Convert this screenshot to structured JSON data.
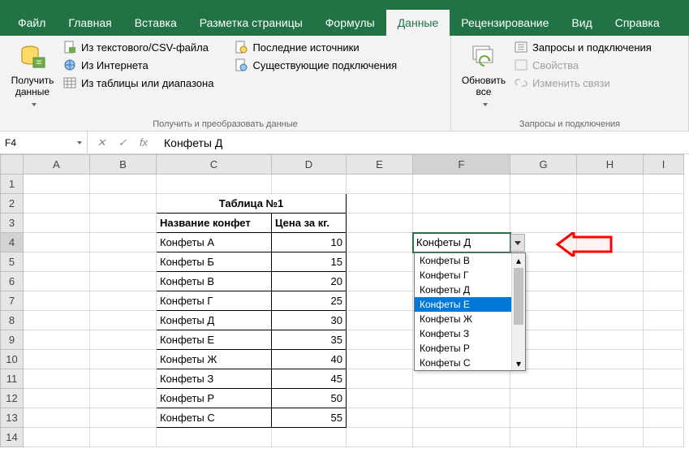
{
  "tabs": [
    "Файл",
    "Главная",
    "Вставка",
    "Разметка страницы",
    "Формулы",
    "Данные",
    "Рецензирование",
    "Вид",
    "Справка"
  ],
  "active_tab": "Данные",
  "ribbon": {
    "group1": {
      "get_data": "Получить\nданные",
      "from_text_csv": "Из текстового/CSV-файла",
      "from_web": "Из Интернета",
      "from_table": "Из таблицы или диапазона",
      "recent": "Последние источники",
      "existing": "Существующие подключения",
      "label": "Получить и преобразовать данные"
    },
    "group2": {
      "refresh": "Обновить\nвсе",
      "queries": "Запросы и подключения",
      "properties": "Свойства",
      "edit_links": "Изменить связи",
      "label": "Запросы и подключения"
    }
  },
  "namebox": "F4",
  "formula": "Конфеты Д",
  "columns": [
    "A",
    "B",
    "C",
    "D",
    "E",
    "F",
    "G",
    "H",
    "I"
  ],
  "rows": [
    1,
    2,
    3,
    4,
    5,
    6,
    7,
    8,
    9,
    10,
    11,
    12,
    13,
    14
  ],
  "table": {
    "title": "Таблица №1",
    "h1": "Название конфет",
    "h2": "Цена за кг.",
    "rows": [
      {
        "name": "Конфеты А",
        "price": "10"
      },
      {
        "name": "Конфеты Б",
        "price": "15"
      },
      {
        "name": "Конфеты В",
        "price": "20"
      },
      {
        "name": "Конфеты Г",
        "price": "25"
      },
      {
        "name": "Конфеты Д",
        "price": "30"
      },
      {
        "name": "Конфеты Е",
        "price": "35"
      },
      {
        "name": "Конфеты Ж",
        "price": "40"
      },
      {
        "name": "Конфеты З",
        "price": "45"
      },
      {
        "name": "Конфеты Р",
        "price": "50"
      },
      {
        "name": "Конфеты С",
        "price": "55"
      }
    ]
  },
  "cell_value": "Конфеты Д",
  "dropdown": {
    "items": [
      "Конфеты В",
      "Конфеты Г",
      "Конфеты Д",
      "Конфеты Е",
      "Конфеты Ж",
      "Конфеты З",
      "Конфеты Р",
      "Конфеты С"
    ],
    "highlighted": "Конфеты Е"
  }
}
